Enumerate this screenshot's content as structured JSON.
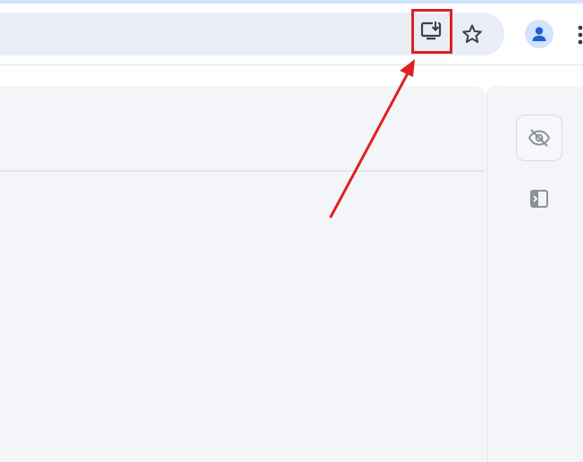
{
  "toolbar": {
    "install_icon": "install-app-icon",
    "bookmark_icon": "star-icon",
    "profile_icon": "person-icon",
    "menu_icon": "more-vert-icon"
  },
  "side_panel": {
    "hide_icon": "eye-off-icon",
    "open_panel_icon": "side-panel-icon"
  },
  "annotation": {
    "highlight_color": "#e02020",
    "arrow_color": "#e02020"
  },
  "colors": {
    "omnibox": "#e9eef6",
    "content_bg": "#f3f5f8",
    "profile_accent": "#1a63d6"
  }
}
